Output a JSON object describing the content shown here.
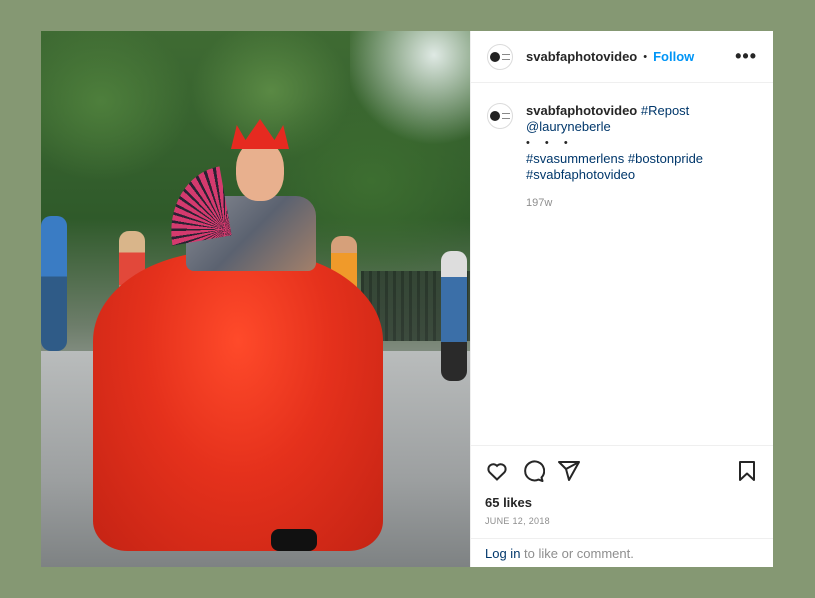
{
  "post": {
    "username": "svabfaphotovideo",
    "separator": "•",
    "follow_label": "Follow",
    "more_label": "•••",
    "caption": {
      "username": "svabfaphotovideo",
      "line1_tag": "#Repost",
      "line2_mention": "@lauryneberle",
      "dots": "• • •",
      "hashtags_line1": "#svasummerlens #bostonpride",
      "hashtags_line2": "#svabfaphotovideo",
      "time_ago": "197w"
    },
    "likes": "65 likes",
    "date": "JUNE 12, 2018",
    "login_link": "Log in",
    "login_suffix": " to like or comment."
  },
  "icons": {
    "like": "heart-icon",
    "comment": "comment-icon",
    "share": "paper-plane-icon",
    "save": "bookmark-icon",
    "more": "more-options-icon"
  },
  "colors": {
    "background": "#859873",
    "follow": "#0095f6",
    "link": "#00376b"
  }
}
